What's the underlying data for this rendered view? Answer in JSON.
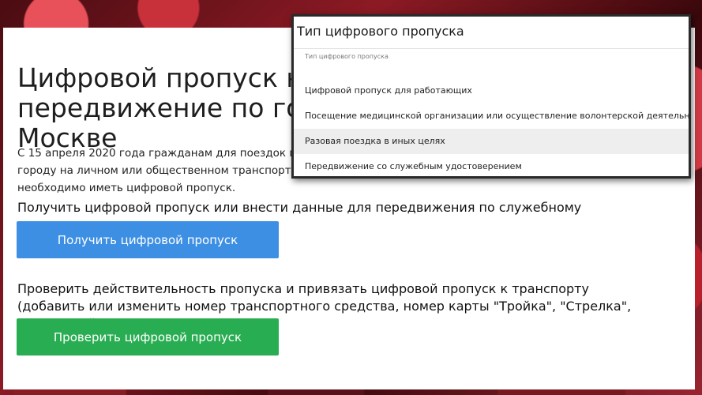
{
  "page": {
    "title": "Цифровой пропуск на передвижение по городу Москве",
    "intro": "С 15 апреля 2020 года гражданам для поездок по городу на личном или общественном транспорте необходимо иметь цифровой пропуск."
  },
  "get_section": {
    "heading": "Получить цифровой пропуск или внести данные для передвижения по служебному удостоверению",
    "button_label": "Получить цифровой пропуск"
  },
  "check_section": {
    "heading": "Проверить действительность пропуска и привязать цифровой пропуск к транспорту (добавить или изменить номер транспортного средства, номер карты \"Тройка\", \"Стрелка\", социальной карты)",
    "button_label": "Проверить цифровой пропуск"
  },
  "pass_type_dropdown": {
    "header": "Тип цифрового пропуска",
    "field_label": "Тип цифрового пропуска",
    "options": [
      "Цифровой пропуск для работающих",
      "Посещение медицинской организации или осуществление волонтерской деятельности",
      "Разовая поездка в иных целях",
      "Передвижение со служебным удостоверением"
    ],
    "highlighted_option": "Разовая поездка в иных целях"
  },
  "colors": {
    "get_button": "#3d8fe3",
    "check_button": "#29ad52"
  }
}
